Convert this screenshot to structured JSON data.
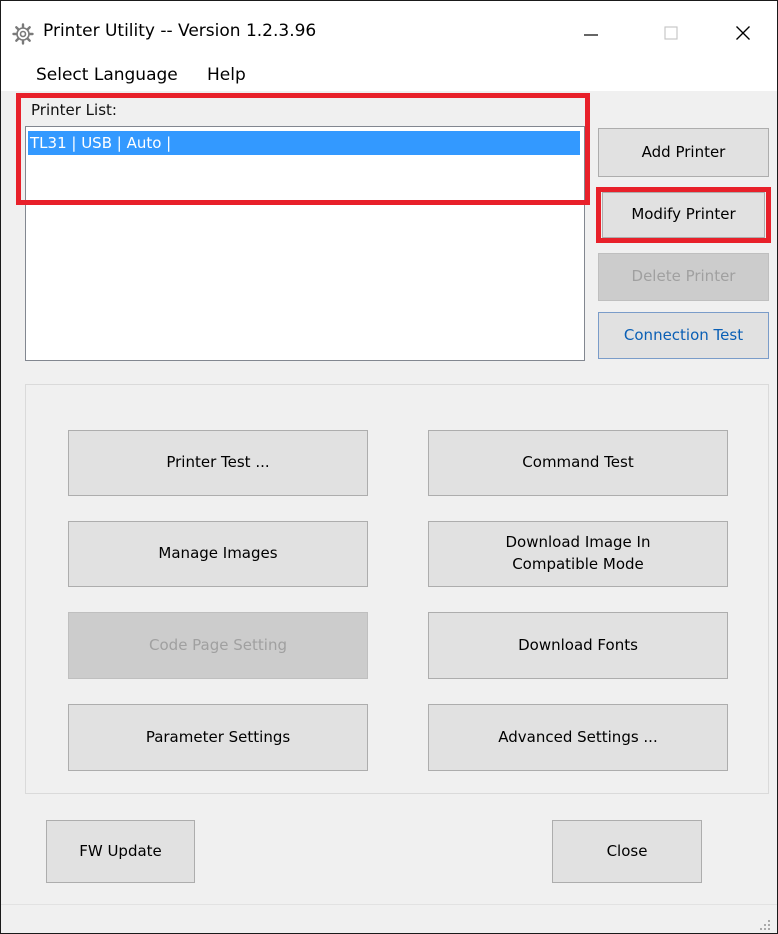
{
  "window": {
    "title": "Printer Utility -- Version 1.2.3.96",
    "icon": "gear-icon",
    "controls": [
      "minimize-icon",
      "maximize-icon",
      "close-icon"
    ]
  },
  "menu": {
    "select_language": "Select Language",
    "help": "Help"
  },
  "printer_list": {
    "label": "Printer List:",
    "items": [
      {
        "text": "TL31 | USB | Auto |",
        "selected": true
      }
    ]
  },
  "side_buttons": {
    "add_printer": "Add Printer",
    "modify_printer": "Modify Printer",
    "delete_printer": "Delete Printer",
    "connection_test": "Connection Test"
  },
  "function_buttons": {
    "printer_test": "Printer Test ...",
    "command_test": "Command Test",
    "manage_images": "Manage Images",
    "download_image_line1": "Download Image In",
    "download_image_line2": "Compatible Mode",
    "code_page_setting": "Code Page Setting",
    "download_fonts": "Download Fonts",
    "parameter_settings": "Parameter Settings",
    "advanced_settings": "Advanced Settings ..."
  },
  "bottom_buttons": {
    "fw_update": "FW Update",
    "close": "Close"
  },
  "colors": {
    "selection": "#3399ff",
    "highlight_outline": "#e8202a",
    "disabled_text": "#a0a0a0",
    "link_text": "#0a5fb5"
  }
}
